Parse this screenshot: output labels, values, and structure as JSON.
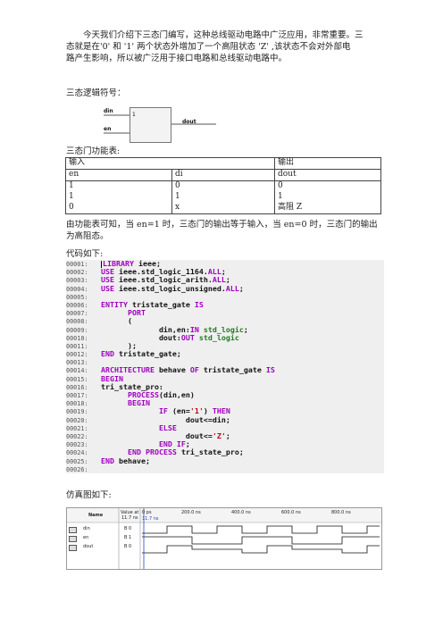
{
  "intro": {
    "line1": "今天我们介绍下三态门编写，这种总线驱动电路中广泛应用，非常重要。三",
    "line2": "态就是在'0' 和 '1' 两个状态外增加了一个高阻状态 'Z' ,该状态不会对外部电",
    "line3": "路产生影响，所以被广泛用于接口电路和总线驱动电路中。"
  },
  "symbol_heading": "三态逻辑符号：",
  "symbol": {
    "din": "din",
    "en": "en",
    "dout": "dout",
    "one": "1"
  },
  "table_heading": "三态门功能表:",
  "table": {
    "group_input": "输入",
    "group_output": "输出",
    "columns": [
      "en",
      "di",
      "dout"
    ],
    "rows": [
      [
        "1",
        "0",
        "0"
      ],
      [
        "1",
        "1",
        "1"
      ],
      [
        "0",
        "x",
        "高阻 Z"
      ]
    ]
  },
  "conclusion": {
    "line1": "由功能表可知，当 en=1 时，三态门的输出等于输入，当 en=0 时，三态门的输出",
    "line2": "为高阻态。"
  },
  "code_heading": "代码如下:",
  "code_lines": [
    {
      "n": "00001:",
      "parts": [
        [
          "kw",
          "LIBRARY "
        ],
        [
          "id",
          "ieee"
        ],
        [
          "pu",
          ";"
        ]
      ]
    },
    {
      "n": "00002:",
      "parts": [
        [
          "kw",
          "USE "
        ],
        [
          "id",
          "ieee.std_logic_1164."
        ],
        [
          "kw",
          "ALL"
        ],
        [
          "pu",
          ";"
        ]
      ]
    },
    {
      "n": "00003:",
      "parts": [
        [
          "kw",
          "USE "
        ],
        [
          "id",
          "ieee.std_logic_arith."
        ],
        [
          "kw",
          "ALL"
        ],
        [
          "pu",
          ";"
        ]
      ]
    },
    {
      "n": "00004:",
      "parts": [
        [
          "kw",
          "USE "
        ],
        [
          "id",
          "ieee.std_logic_unsigned."
        ],
        [
          "kw",
          "ALL"
        ],
        [
          "pu",
          ";"
        ]
      ]
    },
    {
      "n": "00005:",
      "parts": []
    },
    {
      "n": "00006:",
      "parts": [
        [
          "kw",
          "ENTITY "
        ],
        [
          "id",
          "tristate_gate "
        ],
        [
          "kw",
          "IS"
        ]
      ]
    },
    {
      "n": "00007:",
      "parts": [
        [
          "pu",
          "      "
        ],
        [
          "kw",
          "PORT"
        ]
      ]
    },
    {
      "n": "00008:",
      "parts": [
        [
          "pu",
          "      ("
        ]
      ]
    },
    {
      "n": "00009:",
      "parts": [
        [
          "pu",
          "             "
        ],
        [
          "id",
          "din,en:"
        ],
        [
          "kw",
          "IN "
        ],
        [
          "ty",
          "std_logic"
        ],
        [
          "pu",
          ";"
        ]
      ]
    },
    {
      "n": "00010:",
      "parts": [
        [
          "pu",
          "             "
        ],
        [
          "id",
          "dout:"
        ],
        [
          "kw",
          "OUT "
        ],
        [
          "ty",
          "std_logic"
        ]
      ]
    },
    {
      "n": "00011:",
      "parts": [
        [
          "pu",
          "      );"
        ]
      ]
    },
    {
      "n": "00012:",
      "parts": [
        [
          "kw",
          "END "
        ],
        [
          "id",
          "tristate_gate"
        ],
        [
          "pu",
          ";"
        ]
      ]
    },
    {
      "n": "00013:",
      "parts": []
    },
    {
      "n": "00014:",
      "parts": [
        [
          "kw",
          "ARCHITECTURE "
        ],
        [
          "id",
          "behave "
        ],
        [
          "kw",
          "OF "
        ],
        [
          "id",
          "tristate_gate "
        ],
        [
          "kw",
          "IS"
        ]
      ]
    },
    {
      "n": "00015:",
      "parts": [
        [
          "kw",
          "BEGIN"
        ]
      ]
    },
    {
      "n": "00016:",
      "parts": [
        [
          "id",
          "tri_state_pro:"
        ]
      ]
    },
    {
      "n": "00017:",
      "parts": [
        [
          "pu",
          "      "
        ],
        [
          "kw",
          "PROCESS"
        ],
        [
          "id",
          "(din,en)"
        ]
      ]
    },
    {
      "n": "00018:",
      "parts": [
        [
          "pu",
          "      "
        ],
        [
          "kw",
          "BEGIN"
        ]
      ]
    },
    {
      "n": "00019:",
      "parts": [
        [
          "pu",
          "             "
        ],
        [
          "kw",
          "IF "
        ],
        [
          "id",
          "(en="
        ],
        [
          "st",
          "'1'"
        ],
        [
          "id",
          ") "
        ],
        [
          "kw",
          "THEN"
        ]
      ]
    },
    {
      "n": "00020:",
      "parts": [
        [
          "pu",
          "                   "
        ],
        [
          "id",
          "dout<=din;"
        ]
      ]
    },
    {
      "n": "00021:",
      "parts": [
        [
          "pu",
          "             "
        ],
        [
          "kw",
          "ELSE"
        ]
      ]
    },
    {
      "n": "00022:",
      "parts": [
        [
          "pu",
          "                   "
        ],
        [
          "id",
          "dout<="
        ],
        [
          "st",
          "'Z'"
        ],
        [
          "pu",
          ";"
        ]
      ]
    },
    {
      "n": "00023:",
      "parts": [
        [
          "pu",
          "             "
        ],
        [
          "kw",
          "END IF"
        ],
        [
          "pu",
          ";"
        ]
      ]
    },
    {
      "n": "00024:",
      "parts": [
        [
          "pu",
          "      "
        ],
        [
          "kw",
          "END PROCESS "
        ],
        [
          "id",
          "tri_state_pro"
        ],
        [
          "pu",
          ";"
        ]
      ]
    },
    {
      "n": "00025:",
      "parts": [
        [
          "kw",
          "END "
        ],
        [
          "id",
          "behave"
        ],
        [
          "pu",
          ";"
        ]
      ]
    },
    {
      "n": "00026:",
      "parts": []
    }
  ],
  "sim_heading": "仿真图如下:",
  "waveform": {
    "name_header": "Name",
    "value_header_1": "Value at",
    "value_header_2": "11.7 ns",
    "time_labels": [
      "0 ps",
      "200.0 ns",
      "400.0 ns",
      "600.0 ns",
      "800.0 ns"
    ],
    "cursor_label": "11.7 ns",
    "signals": [
      {
        "name": "din",
        "value": "B 0"
      },
      {
        "name": "en",
        "value": "B 1"
      },
      {
        "name": "dout",
        "value": "B 0"
      }
    ]
  }
}
